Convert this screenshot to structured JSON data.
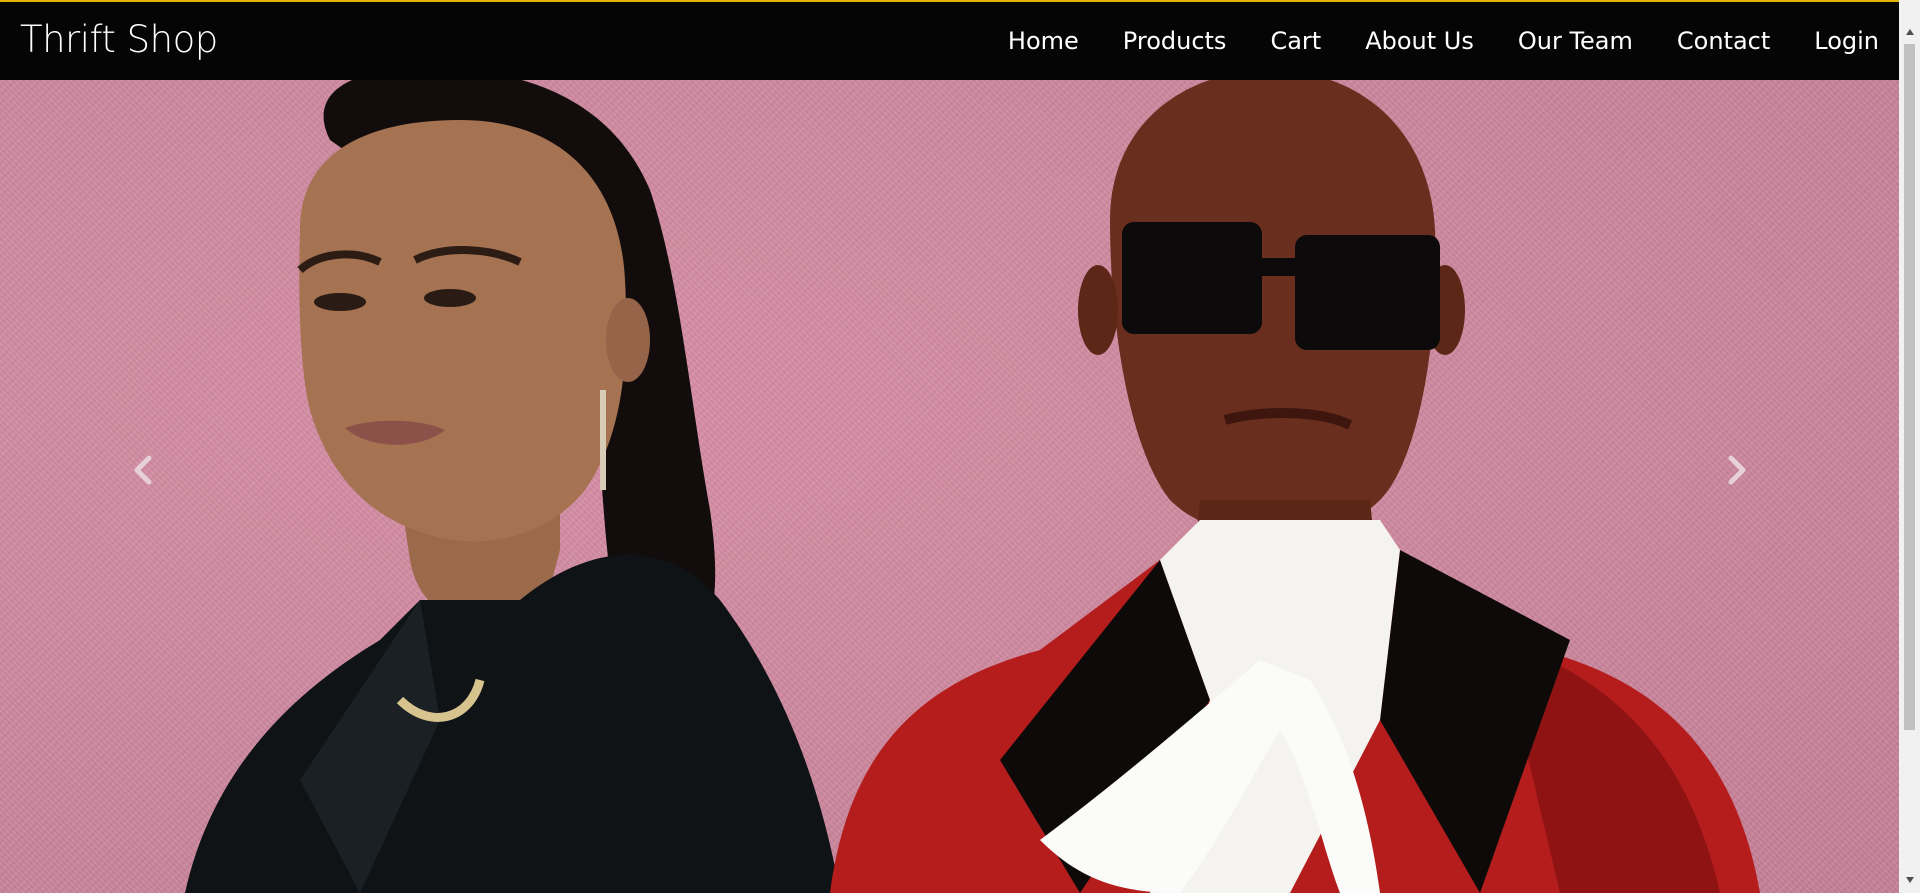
{
  "brand": {
    "title": "Thrift Shop"
  },
  "nav": {
    "items": [
      {
        "label": "Home"
      },
      {
        "label": "Products"
      },
      {
        "label": "Cart"
      },
      {
        "label": "About Us"
      },
      {
        "label": "Our Team"
      },
      {
        "label": "Contact"
      },
      {
        "label": "Login"
      }
    ]
  },
  "carousel": {
    "prev_icon": "chevron-left-icon",
    "next_icon": "chevron-right-icon",
    "slide_image": "two fashion models on pink background"
  },
  "colors": {
    "navbar_bg": "#050505",
    "accent_border": "#e0b400",
    "carousel_bg": "#d088a0",
    "text": "#ffffff"
  }
}
